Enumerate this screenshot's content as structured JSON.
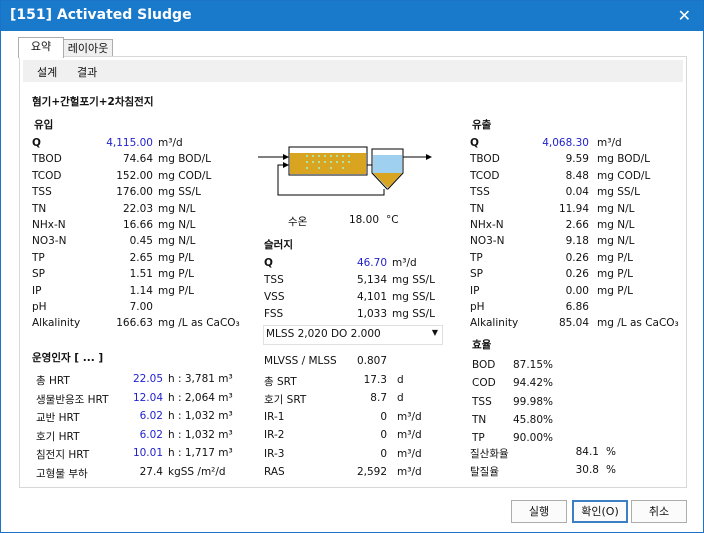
{
  "window": {
    "title": "[151]  Activated Sludge",
    "close": "✕"
  },
  "tabs": [
    "요약",
    "레이아웃"
  ],
  "subtabs": [
    "설계",
    "결과"
  ],
  "process_title": "혐기+간헐포기+2차침전지",
  "influent": {
    "header": "유입",
    "rows": [
      {
        "name": "Q",
        "value": "4,115.00",
        "unit": "m³/d",
        "blue": true
      },
      {
        "name": "TBOD",
        "value": "74.64",
        "unit": "mg BOD/L"
      },
      {
        "name": "TCOD",
        "value": "152.00",
        "unit": "mg COD/L"
      },
      {
        "name": "TSS",
        "value": "176.00",
        "unit": "mg SS/L"
      },
      {
        "name": "TN",
        "value": "22.03",
        "unit": "mg N/L"
      },
      {
        "name": "NHx-N",
        "value": "16.66",
        "unit": "mg N/L"
      },
      {
        "name": "NO3-N",
        "value": "0.45",
        "unit": "mg N/L"
      },
      {
        "name": "TP",
        "value": "2.65",
        "unit": "mg P/L"
      },
      {
        "name": "SP",
        "value": "1.51",
        "unit": "mg P/L"
      },
      {
        "name": "IP",
        "value": "1.14",
        "unit": "mg P/L"
      },
      {
        "name": "pH",
        "value": "7.00",
        "unit": ""
      },
      {
        "name": "Alkalinity",
        "value": "166.63",
        "unit": "mg /L as CaCO₃"
      }
    ]
  },
  "effluent": {
    "header": "유출",
    "rows": [
      {
        "name": "Q",
        "value": "4,068.30",
        "unit": "m³/d",
        "blue": true
      },
      {
        "name": "TBOD",
        "value": "9.59",
        "unit": "mg BOD/L"
      },
      {
        "name": "TCOD",
        "value": "8.48",
        "unit": "mg COD/L"
      },
      {
        "name": "TSS",
        "value": "0.04",
        "unit": "mg SS/L"
      },
      {
        "name": "TN",
        "value": "11.94",
        "unit": "mg N/L"
      },
      {
        "name": "NHx-N",
        "value": "2.66",
        "unit": "mg N/L"
      },
      {
        "name": "NO3-N",
        "value": "9.18",
        "unit": "mg N/L"
      },
      {
        "name": "TP",
        "value": "0.26",
        "unit": "mg P/L"
      },
      {
        "name": "SP",
        "value": "0.26",
        "unit": "mg P/L"
      },
      {
        "name": "IP",
        "value": "0.00",
        "unit": "mg P/L"
      },
      {
        "name": "pH",
        "value": "6.86",
        "unit": ""
      },
      {
        "name": "Alkalinity",
        "value": "85.04",
        "unit": "mg /L as CaCO₃"
      }
    ]
  },
  "temperature": {
    "label": "수온",
    "value": "18.00",
    "unit": "°C"
  },
  "sludge": {
    "header": "슬러지",
    "rows": [
      {
        "name": "Q",
        "value": "46.70",
        "unit": "m³/d",
        "blue": true
      },
      {
        "name": "TSS",
        "value": "5,134",
        "unit": "mg SS/L"
      },
      {
        "name": "VSS",
        "value": "4,101",
        "unit": "mg SS/L"
      },
      {
        "name": "FSS",
        "value": "1,033",
        "unit": "mg SS/L"
      }
    ]
  },
  "dropdown": {
    "value": "MLSS 2,020  DO 2.000",
    "arrow": "▼"
  },
  "operation": {
    "header": "운영인자 [ ... ]",
    "rows": [
      {
        "name": "총 HRT",
        "value": "22.05",
        "unit": "h : 3,781 m³"
      },
      {
        "name": "생물반응조 HRT",
        "value": "12.04",
        "unit": "h : 2,064 m³"
      },
      {
        "name": "교반 HRT",
        "value": "6.02",
        "unit": "h : 1,032 m³"
      },
      {
        "name": "호기 HRT",
        "value": "6.02",
        "unit": "h : 1,032 m³"
      },
      {
        "name": "침전지 HRT",
        "value": "10.01",
        "unit": "h : 1,717 m³"
      },
      {
        "name": "고형물 부하",
        "value": "27.4",
        "unit": "kgSS /m²/d",
        "black": true
      }
    ]
  },
  "mid": {
    "rows": [
      {
        "name": "MLVSS / MLSS",
        "value": "0.807",
        "unit": ""
      },
      {
        "name": "총 SRT",
        "value": "17.3",
        "unit": "d"
      },
      {
        "name": "호기 SRT",
        "value": "8.7",
        "unit": "d"
      },
      {
        "name": "IR-1",
        "value": "0",
        "unit": "m³/d"
      },
      {
        "name": "IR-2",
        "value": "0",
        "unit": "m³/d"
      },
      {
        "name": "IR-3",
        "value": "0",
        "unit": "m³/d"
      },
      {
        "name": "RAS",
        "value": "2,592",
        "unit": "m³/d"
      }
    ]
  },
  "efficiency": {
    "header": "효율",
    "rows": [
      {
        "name": "BOD",
        "value": "87.15%"
      },
      {
        "name": "COD",
        "value": "94.42%"
      },
      {
        "name": "TSS",
        "value": "99.98%"
      },
      {
        "name": "TN",
        "value": "45.80%"
      },
      {
        "name": "TP",
        "value": "90.00%"
      }
    ],
    "extra": [
      {
        "name": "질산화율",
        "value": "84.1",
        "unit": "%"
      },
      {
        "name": "탈질율",
        "value": "30.8",
        "unit": "%"
      }
    ]
  },
  "buttons": {
    "run": "실행",
    "ok": "확인(O)",
    "cancel": "취소"
  },
  "colors": {
    "title_bar": "#1979ca",
    "value_blue": "#2222cc",
    "tank": "#d9a520",
    "clarifier": "#9fd0f0"
  }
}
